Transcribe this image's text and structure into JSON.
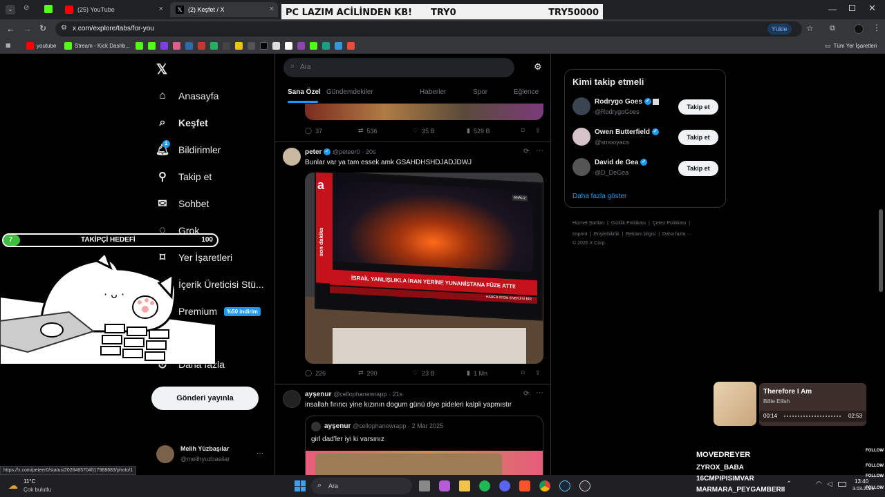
{
  "browser": {
    "tabs": [
      {
        "label": "(25) YouTube"
      },
      {
        "label": "(2) Keşfet / X"
      }
    ],
    "url": "x.com/explore/tabs/for-you",
    "upload_label": "Yükle",
    "bookmarks": [
      "youtube",
      "Stream - Kick Dashb..."
    ],
    "all_bookmarks": "Tüm Yer İşaretleri"
  },
  "banner": {
    "text": "PC LAZIM ACİLİNDEN KB!",
    "current": "TRY0",
    "goal": "TRY50000"
  },
  "nav": {
    "items": [
      "Anasayfa",
      "Keşfet",
      "Bildirimler",
      "Takip et",
      "Sohbet",
      "Grok",
      "Yer İşaretleri",
      "İçerik Üreticisi Stü...",
      "Premium",
      "Daha fazla"
    ],
    "premium_badge": "%50 indirim",
    "notif_count": "2",
    "post_button": "Gönderi yayınla",
    "user_name": "Melih Yüzbaşılar",
    "user_handle": "@melihyuzbasilar",
    "more": "···"
  },
  "follower_goal": {
    "current": "7",
    "label": "TAKİPÇİ HEDEFİ",
    "target": "100"
  },
  "search": {
    "placeholder": "Ara"
  },
  "explore_tabs": [
    "Sana Özel",
    "Gündemdekiler",
    "Haberler",
    "Spor",
    "Eğlence"
  ],
  "post0_actions": {
    "replies": "37",
    "reposts": "536",
    "likes": "35 B",
    "views": "529 B"
  },
  "post1": {
    "name": "peter",
    "handle": "@peteer0",
    "time": "· 20s",
    "text": "Bunlar var ya tam essek amk GSAHDHSHDJADJDWJ",
    "tv_headline": "İSRAİL YANLIŞLIKLA İRAN YERİNE YUNANİSTANA FÜZE ATTI!",
    "tv_tag": "son dakika",
    "tv_logo": "a",
    "tv_corner": "ANALİZ",
    "tv_ticker": "HABER ATOM ENERJİSİ BİR",
    "replies": "226",
    "reposts": "290",
    "likes": "23 B",
    "views": "1 Mn"
  },
  "post2": {
    "name": "ayşenur",
    "handle": "@cellophanewrapp",
    "time": "· 21s",
    "text": "insallah fırıncı yine kızının dogum günü diye pideleri kalpli yapmıstır",
    "quote_name": "ayşenur",
    "quote_handle": "@cellophanewrapp",
    "quote_time": "· 2 Mar 2025",
    "quote_text": "girl dad'ler iyi ki varsınız"
  },
  "who_to_follow": {
    "title": "Kimi takip etmeli",
    "people": [
      {
        "name": "Rodrygo Goes",
        "handle": "@RodrygoGoes"
      },
      {
        "name": "Owen Butterfield",
        "handle": "@smooyacs"
      },
      {
        "name": "David de Gea",
        "handle": "@D_DeGea"
      }
    ],
    "follow_label": "Takip et",
    "show_more": "Daha fazla göster"
  },
  "footer": {
    "row1": [
      "Hizmet Şartları",
      "Gizlilik Politikası",
      "Çerez Politikası"
    ],
    "row2": [
      "Imprint",
      "Erişilebilirlik",
      "Reklam bilgisi",
      "Daha fazla ···"
    ],
    "copyright": "© 2026 X Corp."
  },
  "music": {
    "title": "Therefore I Am",
    "artist": "Billie Eilish",
    "elapsed": "00:14",
    "total": "02:53"
  },
  "stream_list": {
    "names": [
      "MOVEDREYER",
      "ZYROX_BABA",
      "16CMPIPISIMVAR",
      "MARMARA_PEYGAMBERII"
    ],
    "follow_label": "FOLLOW"
  },
  "status_url": "https://x.com/peteer0/status/2028465704517988683/photo/1",
  "taskbar": {
    "temp": "11°C",
    "weather": "Çok bulutlu",
    "search": "Ara",
    "time": "13:40",
    "date": "3.03.2026"
  },
  "colors": {
    "accent": "#1d9bf0",
    "red": "#c4121a",
    "banner_bg": "#f1f1f1"
  }
}
